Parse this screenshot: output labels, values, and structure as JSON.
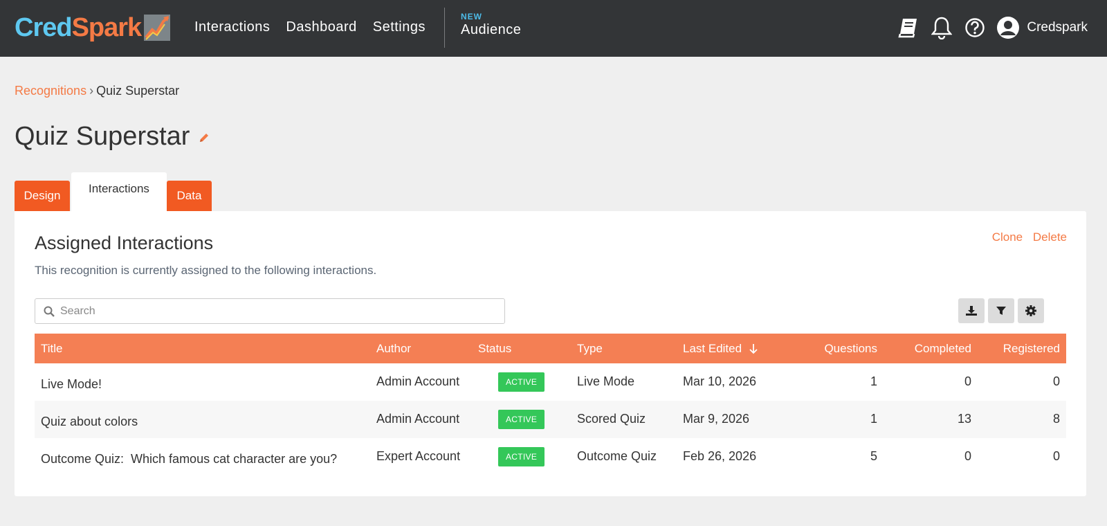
{
  "brand": {
    "logo_part1": "Cred",
    "logo_part2": "Spark",
    "accent_color": "#f15a22",
    "secondary_color": "#5ec8f0"
  },
  "nav": {
    "links": [
      "Interactions",
      "Dashboard",
      "Settings"
    ],
    "audience_badge": "NEW",
    "audience_label": "Audience",
    "icons": [
      "book-icon",
      "bell-icon",
      "help-icon",
      "user-icon"
    ],
    "username": "Credspark"
  },
  "breadcrumb": {
    "parent": "Recognitions",
    "separator": "›",
    "current": "Quiz Superstar"
  },
  "page": {
    "title": "Quiz Superstar"
  },
  "tabs": [
    {
      "label": "Design",
      "active": false
    },
    {
      "label": "Interactions",
      "active": true
    },
    {
      "label": "Data",
      "active": false
    }
  ],
  "section": {
    "title": "Assigned Interactions",
    "description": "This recognition is currently assigned to the following interactions.",
    "actions": {
      "clone": "Clone",
      "delete": "Delete"
    }
  },
  "search": {
    "placeholder": "Search",
    "value": ""
  },
  "toolbar": {
    "icons": [
      "download-icon",
      "filter-icon",
      "gear-icon"
    ]
  },
  "table": {
    "columns": [
      "Title",
      "Author",
      "Status",
      "Type",
      "Last Edited",
      "Questions",
      "Completed",
      "Registered"
    ],
    "sort_column": "Last Edited",
    "sort_direction": "descending",
    "rows": [
      {
        "title": "Live Mode!",
        "author": "Admin Account",
        "status": "ACTIVE",
        "type": "Live Mode",
        "last_edited": "Mar 10, 2026",
        "questions": "1",
        "completed": "0",
        "registered": "0"
      },
      {
        "title": "Quiz about colors",
        "author": "Admin Account",
        "status": "ACTIVE",
        "type": "Scored Quiz",
        "last_edited": "Mar 9, 2026",
        "questions": "1",
        "completed": "13",
        "registered": "8"
      },
      {
        "title": "Outcome Quiz:  Which famous cat character are you?",
        "author": "Expert Account",
        "status": "ACTIVE",
        "type": "Outcome Quiz",
        "last_edited": "Feb 26, 2026",
        "questions": "5",
        "completed": "0",
        "registered": "0"
      }
    ]
  }
}
